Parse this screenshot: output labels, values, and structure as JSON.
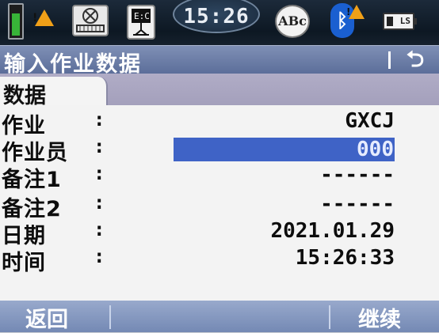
{
  "status_bar": {
    "time": "15:26",
    "abc_label": "ABc",
    "battery_label": "LS",
    "bluetooth_symbol": "ᛒ",
    "warning_symbol": "!",
    "accent_battery": "#38b438",
    "accent_warning": "#f0a018"
  },
  "title_bar": {
    "title": "输入作业数据",
    "back_symbol": "⮌"
  },
  "tabs": [
    {
      "label": "数据"
    }
  ],
  "fields": [
    {
      "label": "作业",
      "value": "GXCJ"
    },
    {
      "label": "作业员",
      "value": "000"
    },
    {
      "label": "备注1",
      "value": "------"
    },
    {
      "label": "备注2",
      "value": "------"
    },
    {
      "label": "日期",
      "value": "2021.01.29"
    },
    {
      "label": "时间",
      "value": "15:26:33"
    }
  ],
  "colon": ":",
  "bottom_bar": {
    "back_label": "返回",
    "continue_label": "继续"
  }
}
